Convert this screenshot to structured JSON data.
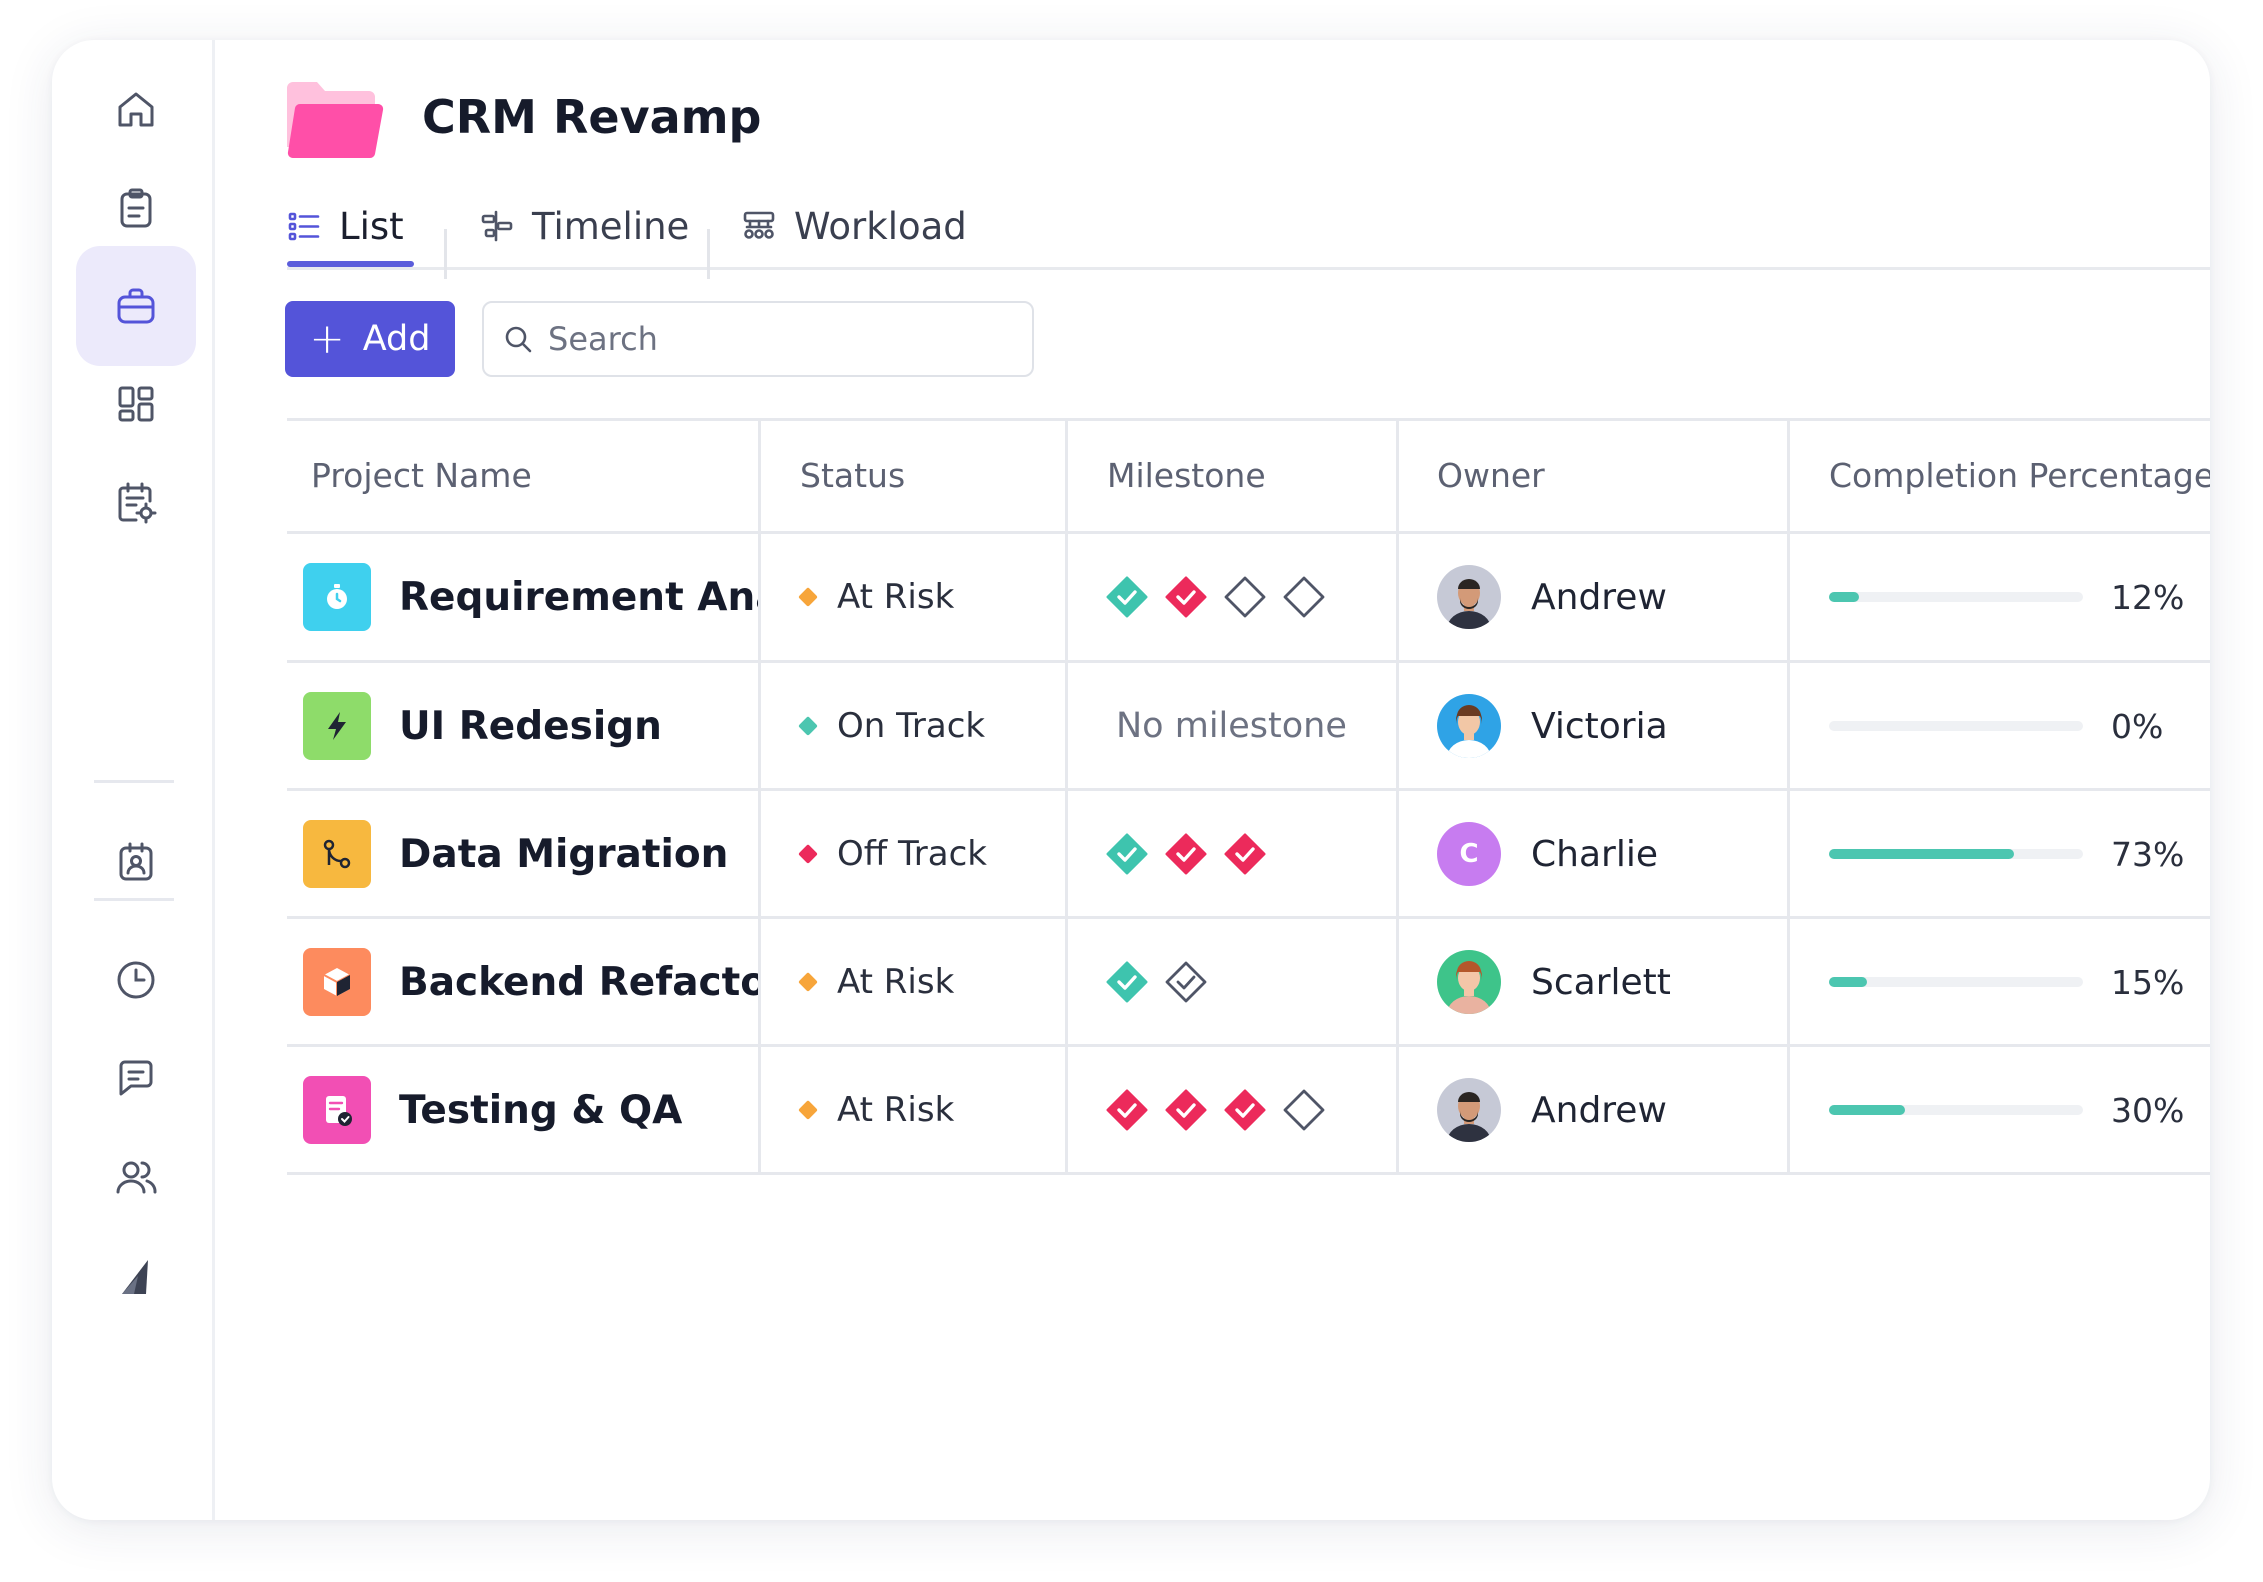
{
  "sidebar": {
    "items": [
      {
        "icon": "home-icon",
        "active": false
      },
      {
        "icon": "clipboard-icon",
        "active": false
      },
      {
        "icon": "briefcase-icon",
        "active": true
      },
      {
        "icon": "dashboard-icon",
        "active": false
      },
      {
        "icon": "calendar-settings-icon",
        "active": false
      },
      {
        "icon": "contact-badge-icon",
        "active": false
      },
      {
        "icon": "clock-icon",
        "active": false
      },
      {
        "icon": "chat-icon",
        "active": false
      },
      {
        "icon": "users-icon",
        "active": false
      },
      {
        "icon": "logo-icon",
        "active": false
      }
    ]
  },
  "project": {
    "title": "CRM Revamp",
    "folder_color": "#ff4fa8"
  },
  "tabs": [
    {
      "label": "List",
      "icon": "list-icon",
      "active": true
    },
    {
      "label": "Timeline",
      "icon": "timeline-icon",
      "active": false
    },
    {
      "label": "Workload",
      "icon": "workload-icon",
      "active": false
    }
  ],
  "toolbar": {
    "add_label": "Add",
    "search_placeholder": "Search"
  },
  "table": {
    "columns": [
      "Project Name",
      "Status",
      "Milestone",
      "Owner",
      "Completion Percentage"
    ],
    "rows": [
      {
        "name": "Requirement Analysis",
        "icon": "stopwatch-icon",
        "icon_bg": "#3fd0ee",
        "status": "At Risk",
        "status_color": "#f7a53a",
        "milestones": [
          "done-teal",
          "done-red",
          "empty",
          "empty"
        ],
        "milestone_text": "",
        "owner": "Andrew",
        "avatar": "andrew",
        "percent_label": "12%",
        "percent": 12
      },
      {
        "name": "UI Redesign",
        "icon": "bolt-icon",
        "icon_bg": "#8edc6a",
        "status": "On Track",
        "status_color": "#4cc6b0",
        "milestones": [],
        "milestone_text": "No milestone",
        "owner": "Victoria",
        "avatar": "victoria",
        "percent_label": "0%",
        "percent": 0
      },
      {
        "name": "Data Migration",
        "icon": "git-branch-icon",
        "icon_bg": "#f7b83f",
        "status": "Off Track",
        "status_color": "#ec2a5b",
        "milestones": [
          "done-teal",
          "done-red",
          "done-red"
        ],
        "milestone_text": "",
        "owner": "Charlie",
        "avatar": "charlie",
        "avatar_letter": "C",
        "percent_label": "73%",
        "percent": 73
      },
      {
        "name": "Backend Refactoring",
        "icon": "cube-icon",
        "icon_bg": "#fd8b5e",
        "status": "At Risk",
        "status_color": "#f7a53a",
        "milestones": [
          "done-teal",
          "done-outline"
        ],
        "milestone_text": "",
        "owner": "Scarlett",
        "avatar": "scarlett",
        "percent_label": "15%",
        "percent": 15
      },
      {
        "name": "Testing & QA",
        "icon": "checklist-icon",
        "icon_bg": "#f24fb4",
        "status": "At Risk",
        "status_color": "#f7a53a",
        "milestones": [
          "done-red",
          "done-red",
          "done-red",
          "empty"
        ],
        "milestone_text": "",
        "owner": "Andrew",
        "avatar": "andrew",
        "percent_label": "30%",
        "percent": 30
      }
    ]
  }
}
